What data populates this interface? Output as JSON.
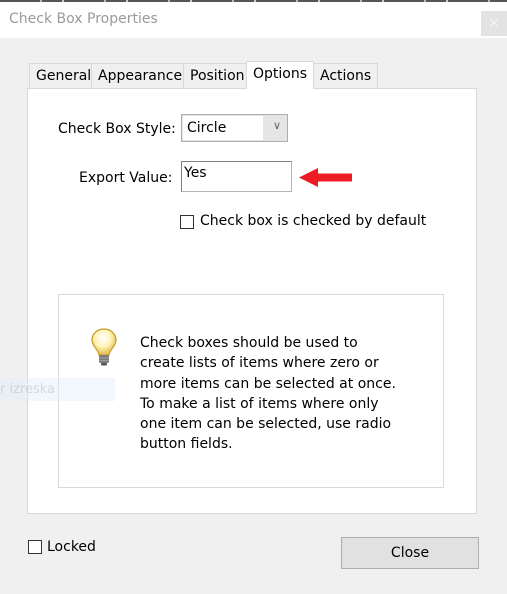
{
  "window": {
    "title": "Check Box Properties",
    "close_glyph": "×"
  },
  "tabs": [
    {
      "label": "General",
      "active": false
    },
    {
      "label": "Appearance",
      "active": false
    },
    {
      "label": "Position",
      "active": false
    },
    {
      "label": "Options",
      "active": true
    },
    {
      "label": "Actions",
      "active": false
    }
  ],
  "options": {
    "style_label": "Check Box Style:",
    "style_value": "Circle",
    "export_label": "Export Value:",
    "export_value": "Yes",
    "default_checked_label": "Check box is checked by default",
    "default_checked": false
  },
  "info": {
    "icon": "lightbulb-icon",
    "lines": [
      "Check boxes should be used to",
      "create lists of items where zero or",
      "more items can be selected at once.",
      "To make a list of items where only",
      "one item can be selected, use radio",
      "button fields."
    ]
  },
  "overlay_text": "r izreska",
  "annotation": {
    "arrow_color": "#ed1c24"
  },
  "footer": {
    "locked_label": "Locked",
    "locked": false,
    "close_label": "Close"
  }
}
